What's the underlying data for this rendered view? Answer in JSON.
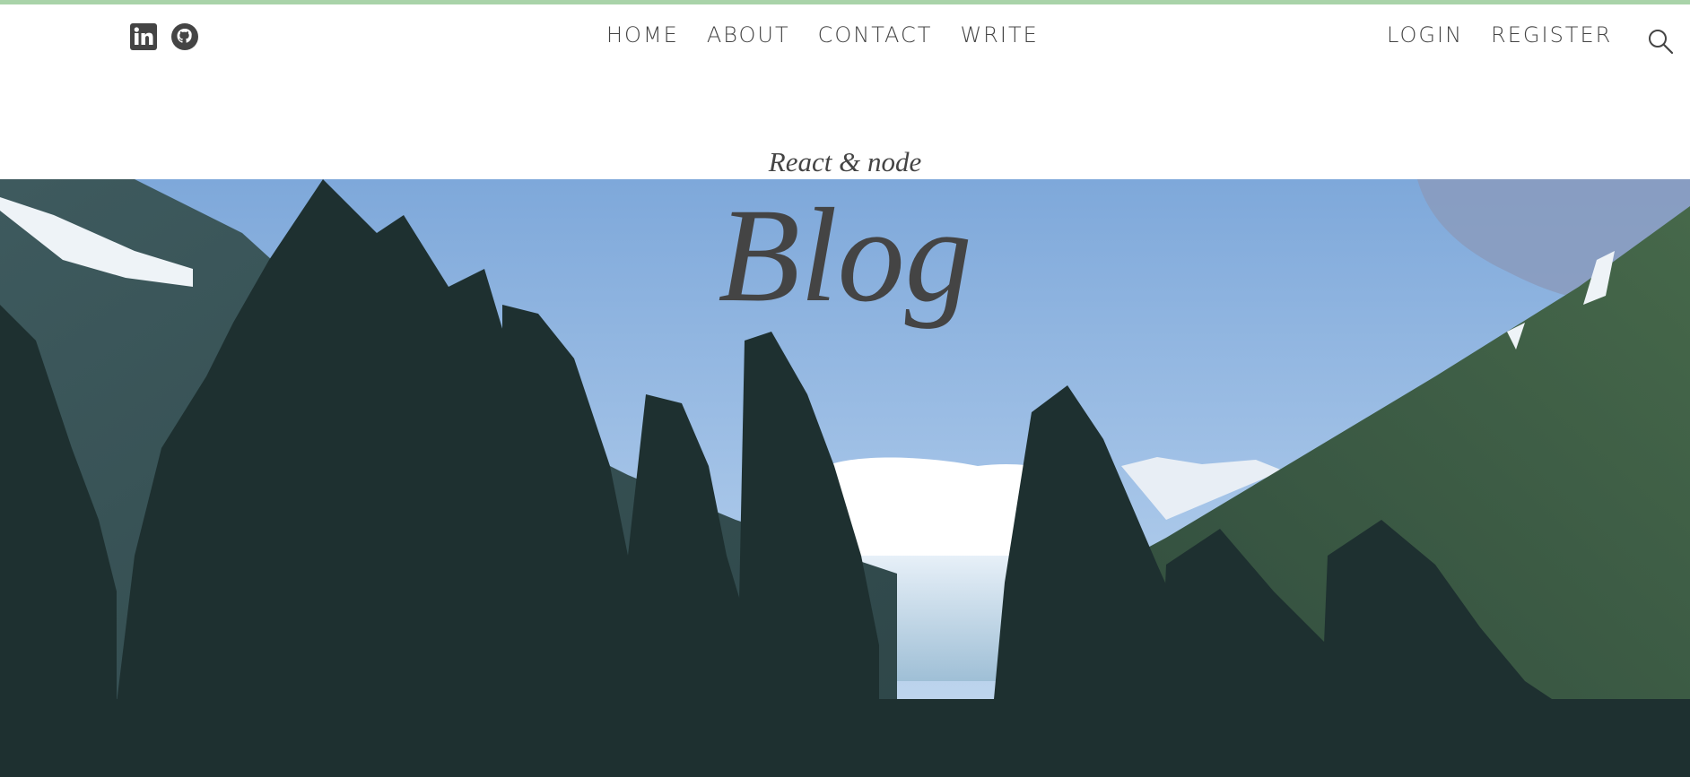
{
  "topbar": {
    "social": [
      {
        "name": "linkedin-icon",
        "color": "#444444"
      },
      {
        "name": "github-icon",
        "color": "#444444"
      }
    ],
    "nav": [
      "HOME",
      "ABOUT",
      "CONTACT",
      "WRITE"
    ],
    "auth": [
      "LOGIN",
      "REGISTER"
    ],
    "search_icon": "search-icon"
  },
  "header": {
    "subtitle": "React & node",
    "title": "Blog"
  },
  "colors": {
    "accent_border": "#a9d3a9",
    "text": "#444444",
    "sky": "#8fb4dd"
  }
}
